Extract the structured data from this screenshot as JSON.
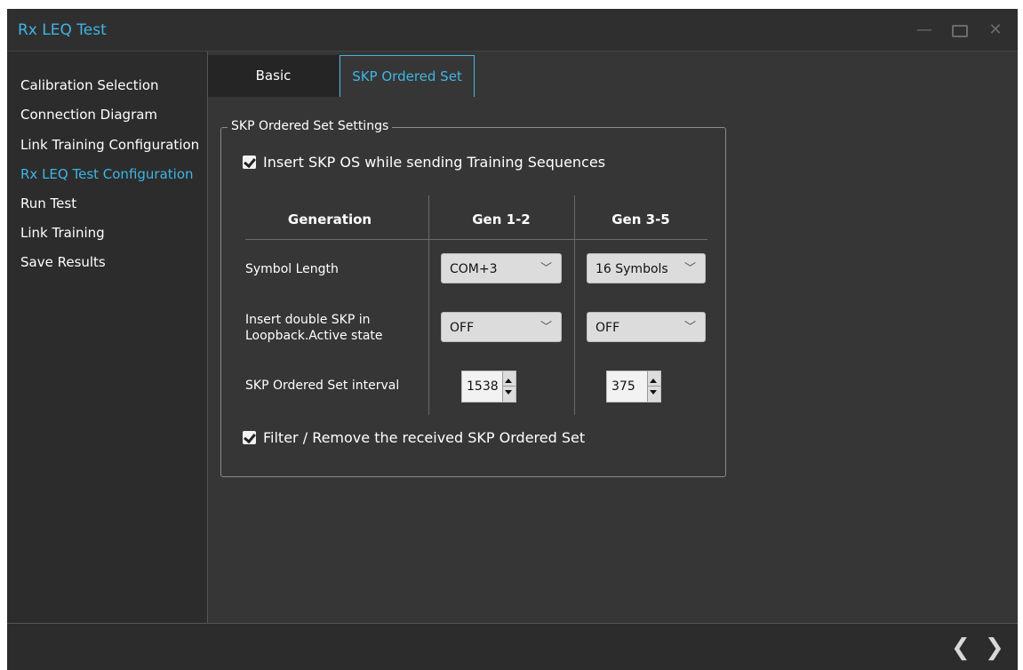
{
  "window": {
    "title": "Rx LEQ Test",
    "controls": {
      "minimize": "—",
      "close": "✕"
    }
  },
  "sidebar": {
    "items": [
      {
        "label": "Calibration Selection",
        "active": false
      },
      {
        "label": "Connection Diagram",
        "active": false
      },
      {
        "label": "Link Training Configuration",
        "active": false
      },
      {
        "label": "Rx LEQ Test Configuration",
        "active": true
      },
      {
        "label": "Run Test",
        "active": false
      },
      {
        "label": "Link Training",
        "active": false
      },
      {
        "label": "Save Results",
        "active": false
      }
    ]
  },
  "tabs": {
    "basic": "Basic",
    "skp": "SKP Ordered Set",
    "active": "SKP Ordered Set"
  },
  "group": {
    "title": "SKP Ordered Set Settings",
    "insert_skp_checkbox": {
      "label": "Insert SKP OS while sending Training Sequences",
      "checked": true
    },
    "filter_checkbox": {
      "label": "Filter / Remove the received SKP Ordered Set",
      "checked": true
    },
    "table": {
      "headers": {
        "generation": "Generation",
        "gen12": "Gen 1-2",
        "gen35": "Gen 3-5"
      },
      "rows": {
        "symbol_length": {
          "label": "Symbol Length",
          "gen12": "COM+3",
          "gen35": "16 Symbols"
        },
        "double_skp": {
          "label_line1": "Insert double SKP in",
          "label_line2": "Loopback.Active state",
          "gen12": "OFF",
          "gen35": "OFF"
        },
        "interval": {
          "label": "SKP Ordered Set interval",
          "gen12": "1538",
          "gen35": "375"
        }
      }
    }
  },
  "footer": {
    "prev": "❮",
    "next": "❯"
  },
  "colors": {
    "accent": "#3fb5e5",
    "background": "#363636",
    "sidebar": "#2c2c2c"
  },
  "icons": {
    "minimize": "minimize-icon",
    "maximize": "maximize-icon",
    "close": "close-icon",
    "chevron": "chevron-down-icon",
    "checkbox": "checkbox-checked-icon",
    "prev": "chevron-left-icon",
    "next": "chevron-right-icon"
  }
}
